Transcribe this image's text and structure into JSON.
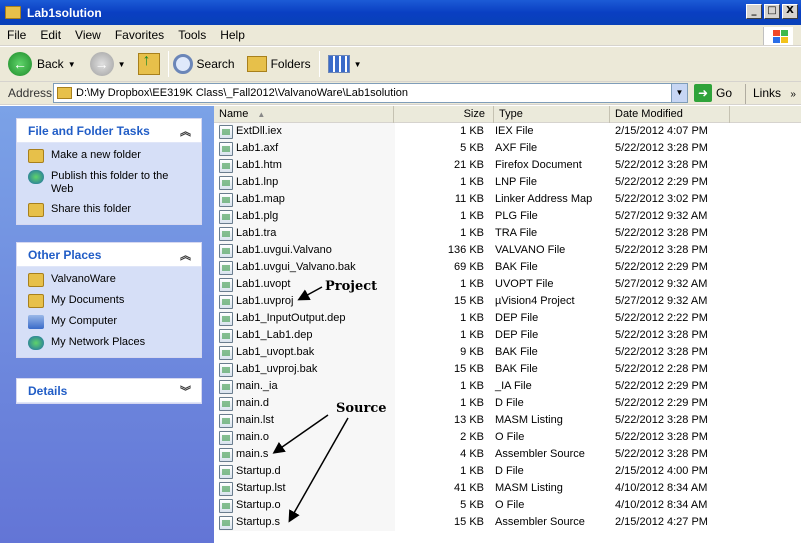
{
  "window": {
    "title": "Lab1solution",
    "min_label": "_",
    "max_label": "□",
    "close_label": "X"
  },
  "menu": [
    "File",
    "Edit",
    "View",
    "Favorites",
    "Tools",
    "Help"
  ],
  "toolbar": {
    "back_label": "Back",
    "search_label": "Search",
    "folders_label": "Folders"
  },
  "address": {
    "label": "Address",
    "path": "D:\\My Dropbox\\EE319K Class\\_Fall2012\\ValvanoWare\\Lab1solution",
    "go_label": "Go",
    "links_label": "Links"
  },
  "tasks": {
    "file_folder": {
      "title": "File and Folder Tasks",
      "items": [
        "Make a new folder",
        "Publish this folder to the Web",
        "Share this folder"
      ]
    },
    "other_places": {
      "title": "Other Places",
      "items": [
        "ValvanoWare",
        "My Documents",
        "My Computer",
        "My Network Places"
      ]
    },
    "details": {
      "title": "Details"
    }
  },
  "columns": {
    "name": "Name",
    "size": "Size",
    "type": "Type",
    "date": "Date Modified"
  },
  "files": [
    {
      "name": "ExtDll.iex",
      "size": "1 KB",
      "type": "IEX File",
      "date": "2/15/2012 4:07 PM"
    },
    {
      "name": "Lab1.axf",
      "size": "5 KB",
      "type": "AXF File",
      "date": "5/22/2012 3:28 PM"
    },
    {
      "name": "Lab1.htm",
      "size": "21 KB",
      "type": "Firefox Document",
      "date": "5/22/2012 3:28 PM"
    },
    {
      "name": "Lab1.lnp",
      "size": "1 KB",
      "type": "LNP File",
      "date": "5/22/2012 2:29 PM"
    },
    {
      "name": "Lab1.map",
      "size": "11 KB",
      "type": "Linker Address Map",
      "date": "5/22/2012 3:02 PM"
    },
    {
      "name": "Lab1.plg",
      "size": "1 KB",
      "type": "PLG File",
      "date": "5/27/2012 9:32 AM"
    },
    {
      "name": "Lab1.tra",
      "size": "1 KB",
      "type": "TRA File",
      "date": "5/22/2012 3:28 PM"
    },
    {
      "name": "Lab1.uvgui.Valvano",
      "size": "136 KB",
      "type": "VALVANO File",
      "date": "5/22/2012 3:28 PM"
    },
    {
      "name": "Lab1.uvgui_Valvano.bak",
      "size": "69 KB",
      "type": "BAK File",
      "date": "5/22/2012 2:29 PM"
    },
    {
      "name": "Lab1.uvopt",
      "size": "1 KB",
      "type": "UVOPT File",
      "date": "5/27/2012 9:32 AM"
    },
    {
      "name": "Lab1.uvproj",
      "size": "15 KB",
      "type": "µVision4 Project",
      "date": "5/27/2012 9:32 AM"
    },
    {
      "name": "Lab1_InputOutput.dep",
      "size": "1 KB",
      "type": "DEP File",
      "date": "5/22/2012 2:22 PM"
    },
    {
      "name": "Lab1_Lab1.dep",
      "size": "1 KB",
      "type": "DEP File",
      "date": "5/22/2012 3:28 PM"
    },
    {
      "name": "Lab1_uvopt.bak",
      "size": "9 KB",
      "type": "BAK File",
      "date": "5/22/2012 3:28 PM"
    },
    {
      "name": "Lab1_uvproj.bak",
      "size": "15 KB",
      "type": "BAK File",
      "date": "5/22/2012 2:28 PM"
    },
    {
      "name": "main._ia",
      "size": "1 KB",
      "type": "_IA File",
      "date": "5/22/2012 2:29 PM"
    },
    {
      "name": "main.d",
      "size": "1 KB",
      "type": "D File",
      "date": "5/22/2012 2:29 PM"
    },
    {
      "name": "main.lst",
      "size": "13 KB",
      "type": "MASM Listing",
      "date": "5/22/2012 3:28 PM"
    },
    {
      "name": "main.o",
      "size": "2 KB",
      "type": "O File",
      "date": "5/22/2012 3:28 PM"
    },
    {
      "name": "main.s",
      "size": "4 KB",
      "type": "Assembler Source",
      "date": "5/22/2012 3:28 PM"
    },
    {
      "name": "Startup.d",
      "size": "1 KB",
      "type": "D File",
      "date": "2/15/2012 4:00 PM"
    },
    {
      "name": "Startup.lst",
      "size": "41 KB",
      "type": "MASM Listing",
      "date": "4/10/2012 8:34 AM"
    },
    {
      "name": "Startup.o",
      "size": "5 KB",
      "type": "O File",
      "date": "4/10/2012 8:34 AM"
    },
    {
      "name": "Startup.s",
      "size": "15 KB",
      "type": "Assembler Source",
      "date": "2/15/2012 4:27 PM"
    }
  ],
  "annotations": {
    "project": "Project",
    "source": "Source"
  }
}
